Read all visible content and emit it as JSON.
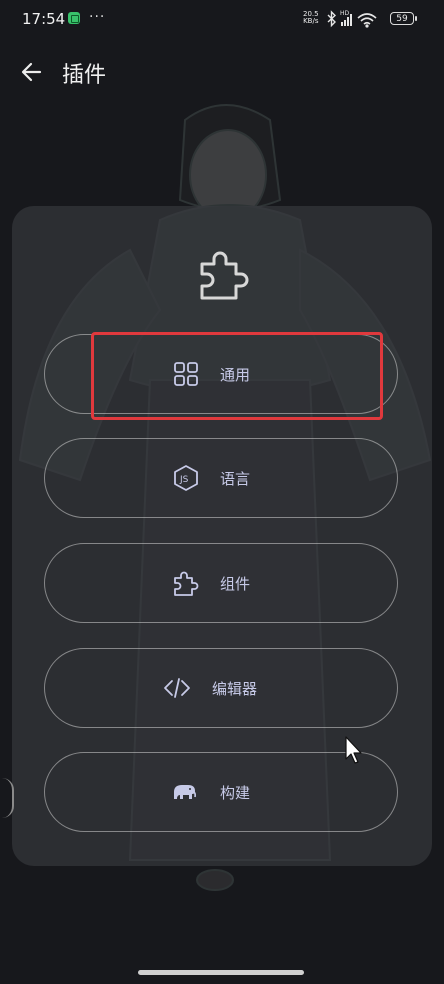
{
  "status_bar": {
    "time": "17:54",
    "net_speed_value": "20.5",
    "net_speed_unit": "KB/s",
    "network_type": "HD",
    "battery": "59"
  },
  "header": {
    "title": "插件"
  },
  "menu": {
    "items": [
      {
        "label": "通用",
        "icon": "grid-icon"
      },
      {
        "label": "语言",
        "icon": "js-icon"
      },
      {
        "label": "组件",
        "icon": "puzzle-icon"
      },
      {
        "label": "编辑器",
        "icon": "code-icon"
      },
      {
        "label": "构建",
        "icon": "elephant-icon"
      }
    ]
  },
  "colors": {
    "background": "#17181c",
    "card": "#3a3c40",
    "accent": "#c7cae8",
    "highlight": "#e0393d"
  }
}
